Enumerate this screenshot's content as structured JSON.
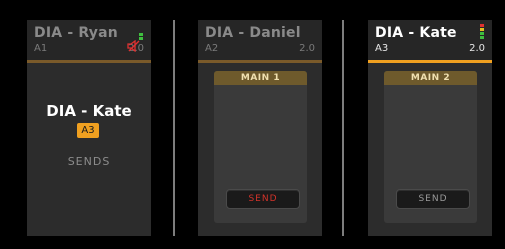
{
  "strips": [
    {
      "name": "DIA - Ryan",
      "channel": "A1",
      "format": "2.0",
      "selected_name": "DIA - Kate",
      "selected_channel": "A3",
      "sends_label": "SENDS"
    },
    {
      "name": "DIA - Daniel",
      "channel": "A2",
      "format": "2.0",
      "bus_title": "MAIN 1",
      "send_label": "SEND"
    },
    {
      "name": "DIA - Kate",
      "channel": "A3",
      "format": "2.0",
      "bus_title": "MAIN 2",
      "send_label": "SEND"
    }
  ],
  "colors": {
    "accent": "#f0a020",
    "send_active": "#d2332a",
    "meter_green": "#3fbf3f",
    "meter_yellow": "#e0c020",
    "meter_red": "#e03030"
  },
  "icons": {
    "mute_indicator": "speaker-mute-icon"
  }
}
